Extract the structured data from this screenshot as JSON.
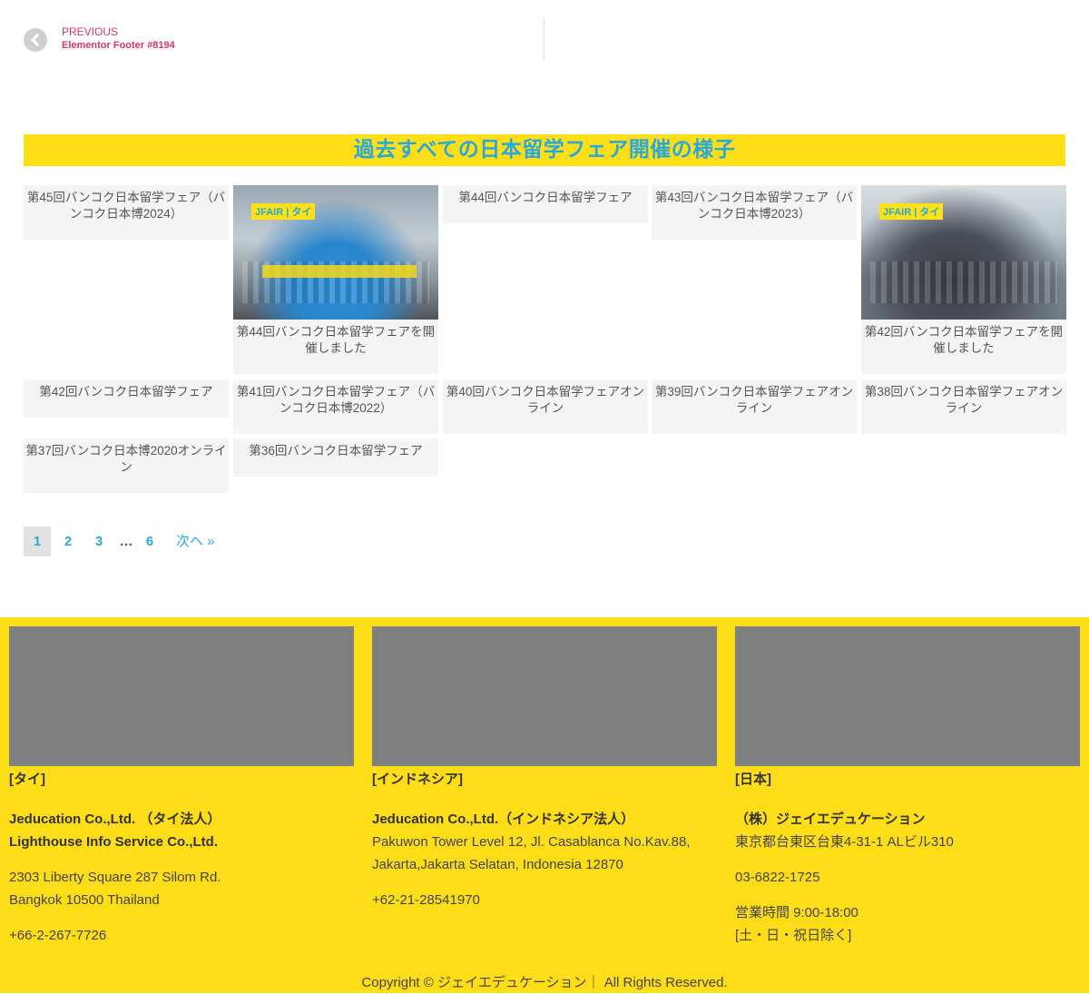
{
  "post_nav": {
    "previous_label": "PREVIOUS",
    "previous_title": "Elementor Footer #8194"
  },
  "section": {
    "heading": "過去すべての日本留学フェア開催の様子"
  },
  "posts": [
    {
      "title": "第45回バンコク日本留学フェア（バンコク日本博2024）"
    },
    {
      "title": "第44回バンコク日本留学フェアを開催しました",
      "thumb_tag": "JFAIR | タイ"
    },
    {
      "title": "第44回バンコク日本留学フェア"
    },
    {
      "title": "第43回バンコク日本留学フェア（バンコク日本博2023）"
    },
    {
      "title": "第42回バンコク日本留学フェアを開催しました",
      "thumb_tag": "JFAIR | タイ"
    },
    {
      "title": "第42回バンコク日本留学フェア"
    },
    {
      "title": "第41回バンコク日本留学フェア（バンコク日本博2022）"
    },
    {
      "title": "第40回バンコク日本留学フェアオンライン"
    },
    {
      "title": "第39回バンコク日本留学フェアオンライン"
    },
    {
      "title": "第38回バンコク日本留学フェアオンライン"
    },
    {
      "title": "第37回バンコク日本博2020オンライン"
    },
    {
      "title": "第36回バンコク日本留学フェア"
    }
  ],
  "pagination": {
    "current": "1",
    "page2": "2",
    "page3": "3",
    "dots": "…",
    "last": "6",
    "next": "次へ »"
  },
  "footer": {
    "thailand": {
      "region": "[タイ]",
      "company1": "Jeducation Co.,Ltd. （タイ法人）",
      "company2": "Lighthouse Info Service Co.,Ltd.",
      "address1": "2303 Liberty Square 287 Silom Rd.",
      "address2": "Bangkok 10500 Thailand",
      "phone": "+66-2-267-7726"
    },
    "indonesia": {
      "region": "[インドネシア]",
      "company": "Jeducation Co.,Ltd.（インドネシア法人）",
      "address1": "Pakuwon Tower Level 12, Jl. Casablanca No.Kav.88,",
      "address2": "Jakarta,Jakarta Selatan, Indonesia 12870",
      "phone": "+62-21-28541970"
    },
    "japan": {
      "region": "[日本]",
      "company": "（株）ジェイエデュケーション",
      "address": "東京都台東区台東4-31-1 ALビル310",
      "phone": "03-6822-1725",
      "hours": "営業時間 9:00-18:00",
      "closed": "[土・日・祝日除く]"
    },
    "copyright": "Copyright © ジェイエデュケーション｜ All Rights Reserved."
  },
  "colors": {
    "accent_yellow": "#fddd17",
    "accent_blue": "#29a8dc",
    "link_pink": "#d8336b"
  }
}
